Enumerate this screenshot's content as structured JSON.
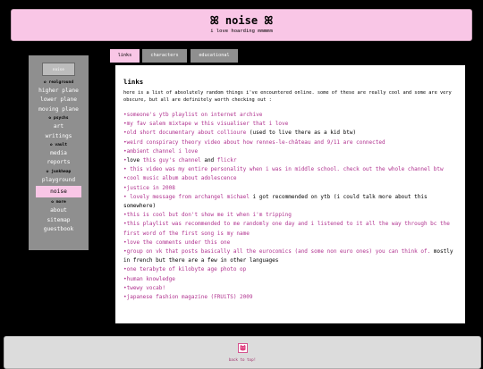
{
  "header": {
    "title": "ꕤ noise ꕤ",
    "subtitle": "i love hoarding mmmmm"
  },
  "sidebar": {
    "logo_text": "noise",
    "sections": {
      "realground": "✿ realground",
      "psychs": "✿ psychs",
      "vault": "✿ vault",
      "junkheap": "✿ junkheap",
      "more": "✿ more"
    },
    "links": {
      "higher_plane": "higher plane",
      "lower_plane": "lower plane",
      "moving_plane": "moving plane",
      "art": "art",
      "writings": "writings",
      "media": "media",
      "reports": "reports",
      "playground": "playground",
      "noise": "noise",
      "about": "about",
      "sitemap": "sitemap",
      "guestbook": "guestbook"
    }
  },
  "tabs": [
    "links",
    "characters",
    "educational"
  ],
  "content": {
    "heading": "links",
    "intro": "here is a list of absolutely random things i've encountered online. some of these are really cool and some are very obscure, but all are definitely worth checking out :",
    "items": [
      {
        "bullet": "•",
        "link": "someone's ytb playlist on internet archive"
      },
      {
        "bullet": "•",
        "link": "my fav salem mixtape w this visualiser that i love"
      },
      {
        "bullet": "•",
        "link": "old short documentary about collioure",
        "after": " (used to live there as a kid btw)"
      },
      {
        "bullet": "•",
        "link": "weird conspiracy theory video about how rennes-le-château and 9/11 are connected"
      },
      {
        "bullet": "•",
        "link": "ambient channel i love"
      },
      {
        "bullet": "•",
        "before": "love ",
        "link": "this guy's channel",
        "middle": " and ",
        "link2": "flickr"
      },
      {
        "bullet": "•",
        "link": " this video was my entire personality when i was in middle school. check out the whole channel btw"
      },
      {
        "bullet": "•",
        "link": "cool music album about adolescence"
      },
      {
        "bullet": "•",
        "link": "justice in 2008"
      },
      {
        "bullet": "•",
        "link": " lovely message from archangel michael",
        "after": " i got recommended on ytb (i could talk more about this somewhere)"
      },
      {
        "bullet": "•",
        "link": "this is cool but don't show me it when i'm tripping"
      },
      {
        "bullet": "•",
        "link": "this playlist was recommended to me randomly one day and i listened to it all the way through bc the first word of the first song is my name"
      },
      {
        "bullet": "•",
        "link": "love the comments under this one"
      },
      {
        "bullet": "•",
        "link": "group on vk that posts basically all the eurocomics (and some non euro ones) you can think of.",
        "after": " mostly in french but there are a few in other languages"
      },
      {
        "bullet": "•",
        "link": "one terabyte of kilobyte age photo op"
      },
      {
        "bullet": "•",
        "link": "human knowledge"
      },
      {
        "bullet": "•",
        "link": "twewy vocab!"
      },
      {
        "bullet": "•",
        "link": "japanese fashion magazine (FRUiTS) 2009"
      }
    ]
  },
  "footer": {
    "icon": "pink-cat-icon",
    "back_to_top": "back to top!"
  },
  "colors": {
    "accent_pink": "#f9c6e6",
    "link_color": "#b0328f",
    "sidebar_gray": "#8f8f8f"
  }
}
